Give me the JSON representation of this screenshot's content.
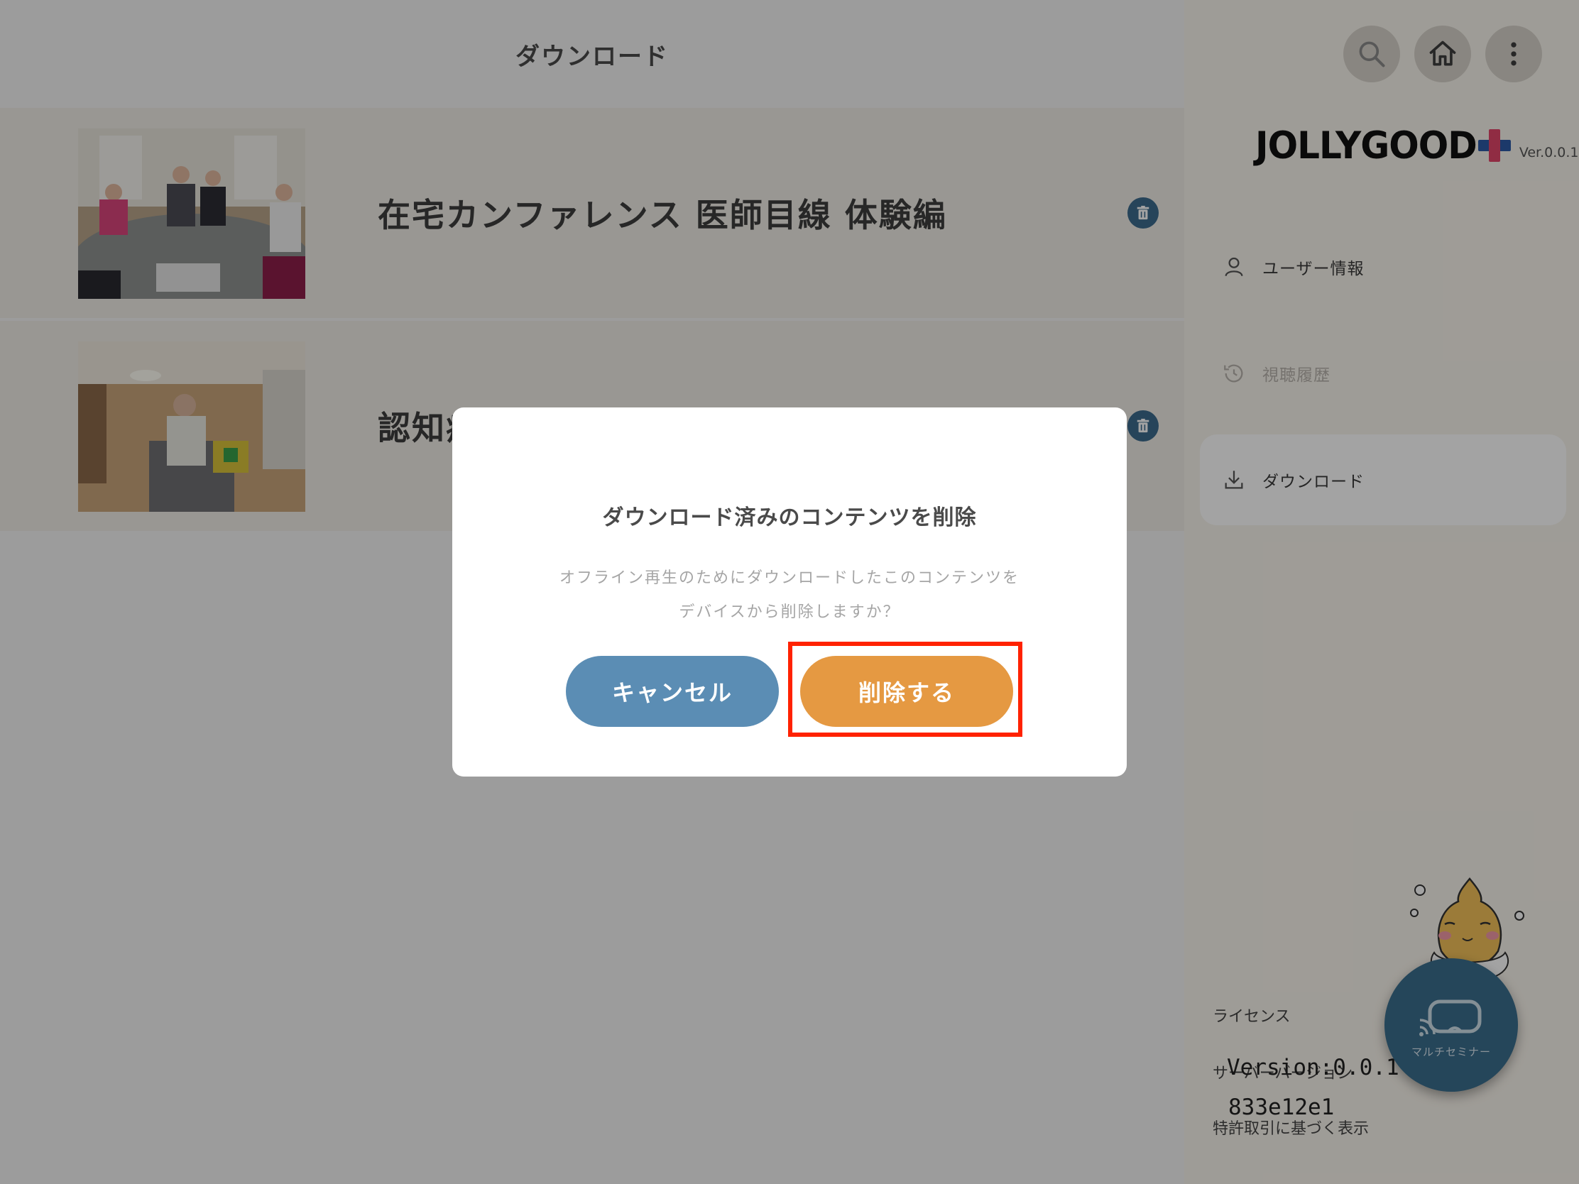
{
  "header": {
    "title": "ダウンロード"
  },
  "downloads": [
    {
      "title": "在宅カンファレンス 医師目線 体験編"
    },
    {
      "title": "認知症"
    }
  ],
  "sidebar": {
    "logo": {
      "text": "JOLLYGOOD",
      "version": "Ver.0.0.1"
    },
    "nav": [
      {
        "label": "ユーザー情報",
        "icon": "user-icon"
      },
      {
        "label": "視聴履歴",
        "icon": "history-icon"
      },
      {
        "label": "ダウンロード",
        "icon": "download-icon",
        "active": true
      }
    ],
    "license": "ライセンス",
    "server": "サーバーバージョン",
    "version": "Version:0.0.1",
    "hash": "833e12e1",
    "patent": "特許取引に基づく表示",
    "fab_label": "マルチセミナー"
  },
  "dialog": {
    "title": "ダウンロード済みのコンテンツを削除",
    "message_line1": "オフライン再生のためにダウンロードしたこのコンテンツを",
    "message_line2": "デバイスから削除しますか？",
    "cancel_label": "キャンセル",
    "delete_label": "削除する"
  },
  "colors": {
    "cancel": "#5b8db4",
    "delete": "#e59942",
    "highlight": "#ff2200",
    "fab": "#3a6e8d"
  }
}
